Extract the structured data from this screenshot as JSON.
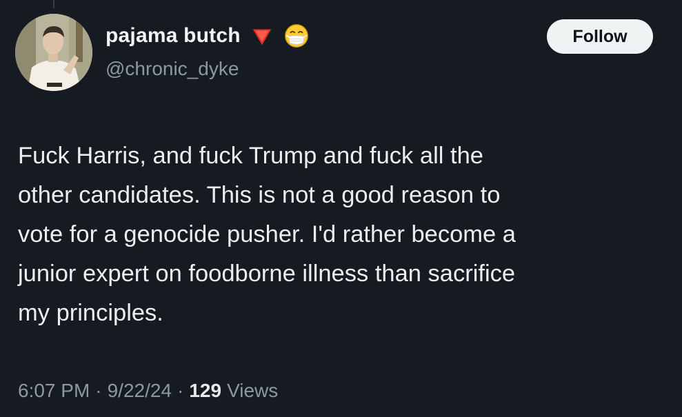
{
  "user": {
    "display_name": "pajama butch",
    "handle": "@chronic_dyke",
    "badges": [
      "red-triangle-icon",
      "face-with-mask-icon"
    ]
  },
  "follow_label": "Follow",
  "tweet": {
    "text": "Fuck Harris, and fuck Trump and fuck all the\nother candidates. This is not a good reason to\nvote for a genocide pusher. I'd rather become a\njunior expert on foodborne illness than sacrifice\nmy principles."
  },
  "meta": {
    "time": "6:07 PM",
    "separator": "·",
    "date": "9/22/24",
    "views_count": "129",
    "views_label": "Views"
  },
  "colors": {
    "background": "#161b22",
    "text": "#e7e9ea",
    "secondary_text": "#8b98a5",
    "follow_button_bg": "#eff3f4",
    "badge_red": "#e0302a"
  }
}
